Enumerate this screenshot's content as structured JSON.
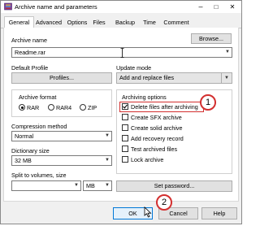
{
  "window": {
    "title": "Archive name and parameters",
    "minimize": "–",
    "maximize": "□",
    "close": "✕"
  },
  "tabs": [
    "General",
    "Advanced",
    "Options",
    "Files",
    "Backup",
    "Time",
    "Comment"
  ],
  "archive_name": {
    "label": "Archive name",
    "value": "Readme.rar",
    "browse": "Browse..."
  },
  "default_profile": {
    "label": "Default Profile",
    "button": "Profiles..."
  },
  "update_mode": {
    "label": "Update mode",
    "value": "Add and replace files"
  },
  "archive_format": {
    "label": "Archive format",
    "options": [
      "RAR",
      "RAR4",
      "ZIP"
    ],
    "selected": "RAR"
  },
  "archiving_options": {
    "label": "Archiving options",
    "items": [
      {
        "label": "Delete files after archiving",
        "checked": true
      },
      {
        "label": "Create SFX archive",
        "checked": false
      },
      {
        "label": "Create solid archive",
        "checked": false
      },
      {
        "label": "Add recovery record",
        "checked": false
      },
      {
        "label": "Test archived files",
        "checked": false
      },
      {
        "label": "Lock archive",
        "checked": false
      }
    ]
  },
  "compression": {
    "label": "Compression method",
    "value": "Normal"
  },
  "dictionary": {
    "label": "Dictionary size",
    "value": "32 MB"
  },
  "split": {
    "label": "Split to volumes, size",
    "value": "",
    "unit": "MB"
  },
  "set_password": "Set password...",
  "buttons": {
    "ok": "OK",
    "cancel": "Cancel",
    "help": "Help"
  },
  "annotations": [
    "1",
    "2"
  ],
  "colors": {
    "annotation": "#d32f2f",
    "combo_border": "#7a7a7a"
  },
  "icons": {
    "title": "winrar-icon",
    "checked": "checkmark-icon",
    "dropdown": "chevron-down-icon",
    "cursor": "text-cursor-icon",
    "pointer": "mouse-pointer-icon"
  }
}
